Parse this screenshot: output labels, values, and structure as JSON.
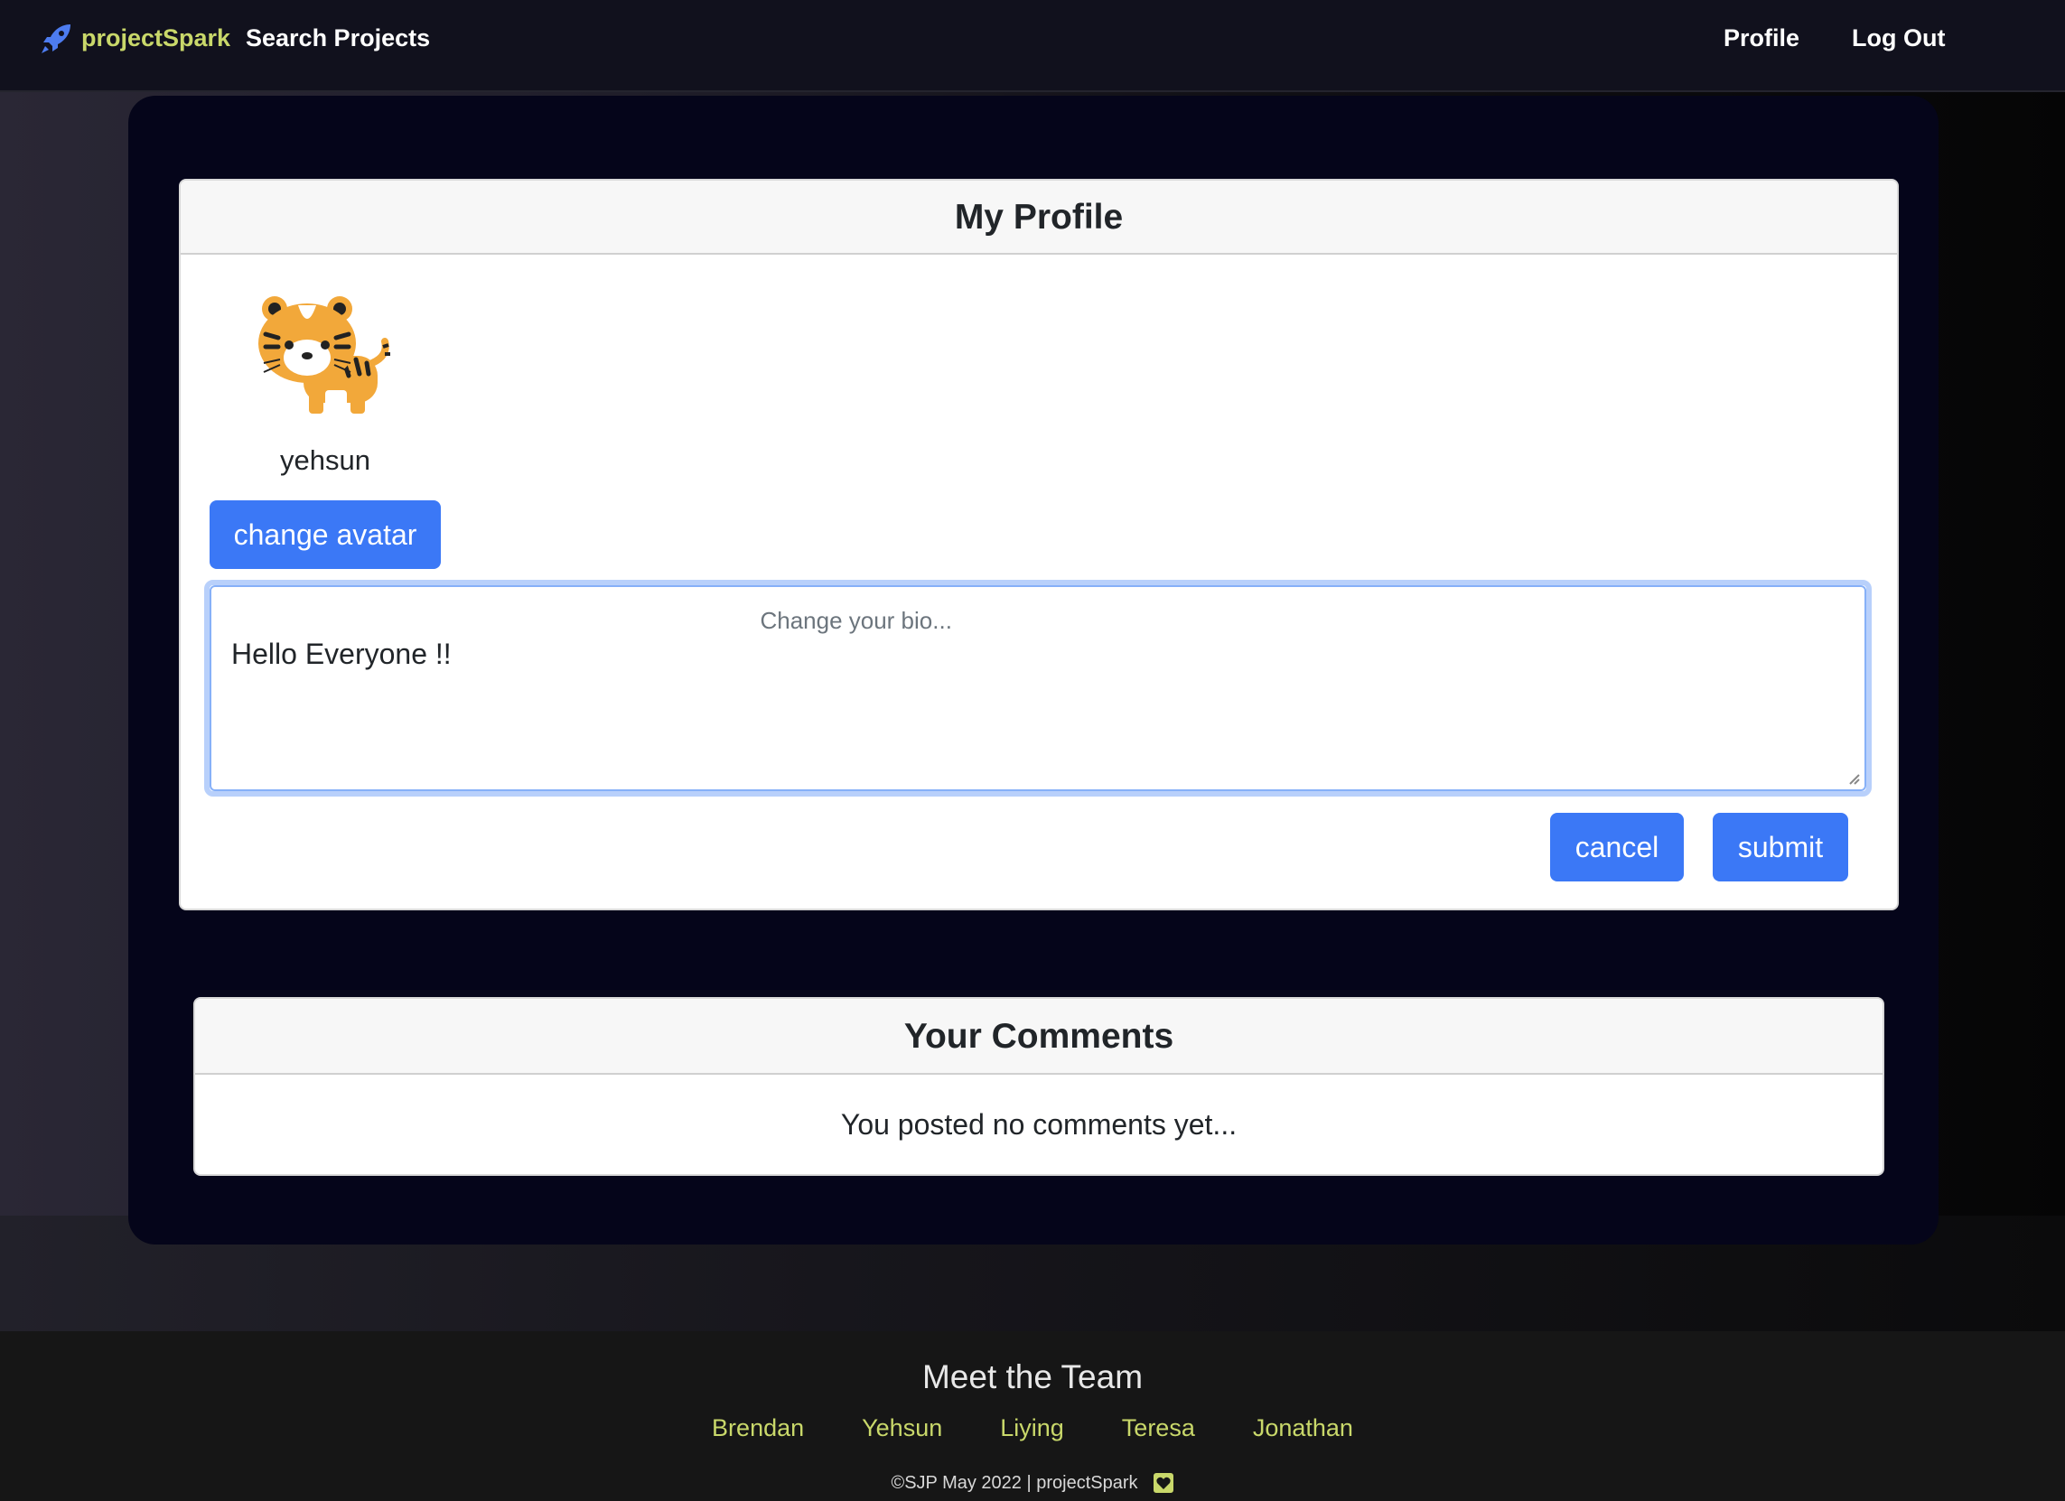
{
  "navbar": {
    "brand": "projectSpark",
    "search_label": "Search Projects",
    "profile_label": "Profile",
    "logout_label": "Log Out",
    "brand_color": "#c9d86a",
    "rocket_icon": "rocket-icon"
  },
  "profile": {
    "title": "My Profile",
    "username": "yehsun",
    "avatar_icon": "tiger-avatar",
    "change_avatar_label": "change avatar",
    "bio_placeholder": "Change your bio...",
    "bio_value": "Hello Everyone !!",
    "cancel_label": "cancel",
    "submit_label": "submit",
    "button_color": "#3b78f6"
  },
  "comments": {
    "title": "Your Comments",
    "empty_text": "You posted no comments yet..."
  },
  "footer": {
    "title": "Meet the Team",
    "team": [
      "Brendan",
      "Yehsun",
      "Liying",
      "Teresa",
      "Jonathan"
    ],
    "copyright": "©SJP May 2022 | projectSpark",
    "heart_icon": "heart-icon"
  }
}
